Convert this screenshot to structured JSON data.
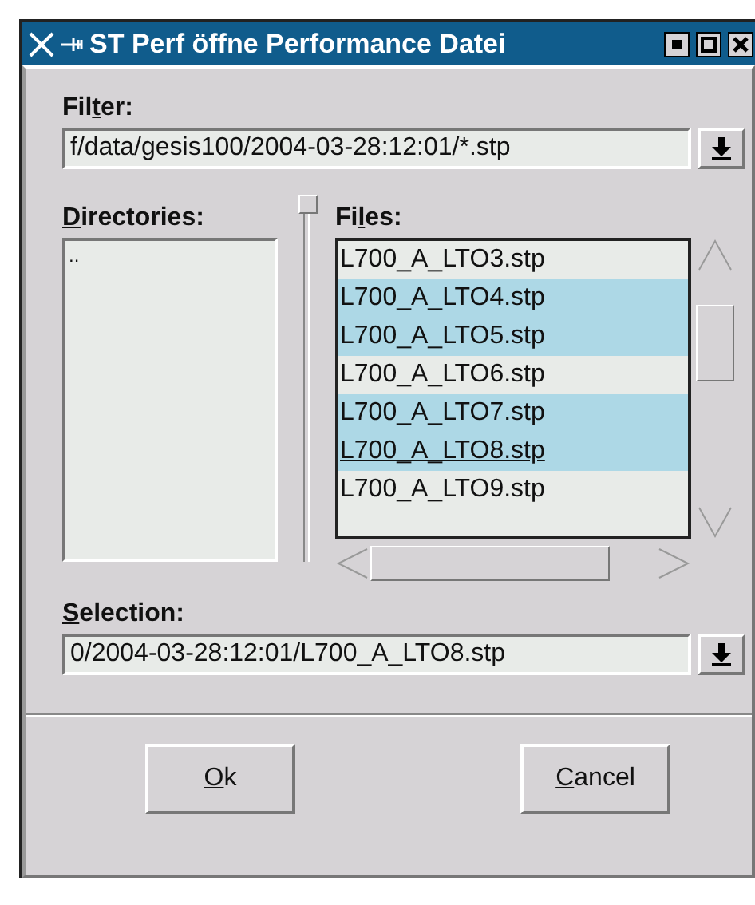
{
  "window": {
    "title": "ST Perf öffne Performance Datei"
  },
  "filter": {
    "label": {
      "before": "Fil",
      "key": "t",
      "after": "er:"
    },
    "value": "f/data/gesis100/2004-03-28:12:01/*.stp"
  },
  "directories": {
    "label": {
      "key": "D",
      "after": "irectories:"
    },
    "items": [
      {
        "name": "..",
        "selected": false
      }
    ]
  },
  "files": {
    "label": {
      "before": "Fi",
      "key": "l",
      "after": "es:"
    },
    "items": [
      {
        "name": "L700_A_LTO3.stp",
        "selected": false,
        "focused": false
      },
      {
        "name": "L700_A_LTO4.stp",
        "selected": true,
        "focused": false
      },
      {
        "name": "L700_A_LTO5.stp",
        "selected": true,
        "focused": false
      },
      {
        "name": "L700_A_LTO6.stp",
        "selected": false,
        "focused": false
      },
      {
        "name": "L700_A_LTO7.stp",
        "selected": true,
        "focused": false
      },
      {
        "name": "L700_A_LTO8.stp",
        "selected": true,
        "focused": true
      },
      {
        "name": "L700_A_LTO9.stp",
        "selected": false,
        "focused": false
      }
    ]
  },
  "selection": {
    "label": {
      "key": "S",
      "after": "election:"
    },
    "value": "0/2004-03-28:12:01/L700_A_LTO8.stp"
  },
  "buttons": [
    {
      "key": "O",
      "after": "k"
    },
    {
      "key": "C",
      "after": "ancel"
    }
  ]
}
